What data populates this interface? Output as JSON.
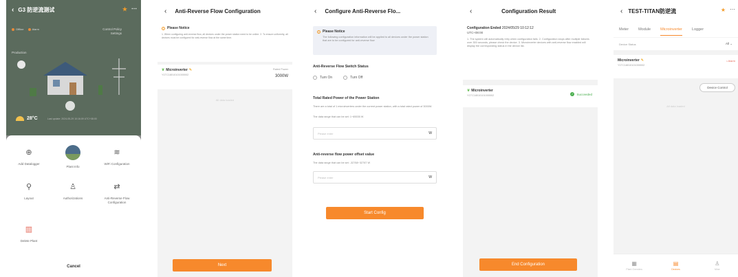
{
  "screen1": {
    "title": "G3 防逆流测试",
    "chips": [
      "Offline",
      "Alarm"
    ],
    "policy": "Control Policy Settings",
    "production": "Production",
    "temperature": "28°C",
    "note": "Last update: 2024-05-29 10:16:09 UTC+08:00",
    "menu": [
      {
        "icon": "⊕",
        "name": "add-icon",
        "label": "Add Datalogger"
      },
      {
        "icon": "",
        "name": "plant-photo-icon",
        "label": "Plant Info"
      },
      {
        "icon": "≋",
        "name": "wifi-icon",
        "label": "WiFi Configuration"
      },
      {
        "icon": "⚲",
        "name": "layout-icon",
        "label": "Layout"
      },
      {
        "icon": "♙",
        "name": "user-icon",
        "label": "Authorizations"
      },
      {
        "icon": "⇄",
        "name": "reverse-flow-icon",
        "label": "Anti-Reverse Flow Configuration"
      },
      {
        "icon": "▥",
        "name": "delete-icon",
        "label": "Delete Plant"
      }
    ],
    "cancel": "Cancel"
  },
  "screen2": {
    "title": "Anti-Reverse Flow Configuration",
    "notice_title": "Please Notice",
    "notice_text": "1. When configuring anti-reverse flow, all devices under the power station need to be online. 2. To ensure uniformity, all devices must be configured for anti-reverse flow at the same time.",
    "device_name": "Microinverter",
    "device_sn": "Y1TC18010101000002",
    "rated_label": "Rated Power",
    "rated_value": "3000W",
    "no_data": "All data loaded",
    "next": "Next"
  },
  "screen3": {
    "title": "Configure Anti-Reverse Flo...",
    "notice_title": "Please Notice",
    "notice_text": "The following configuration information will be applied to all devices under the power station that are to be configured for anti-reverse flow",
    "switch_title": "Anti-Reverse Flow Switch Status",
    "turn_on": "Turn On",
    "turn_off": "Turn Off",
    "total_title": "Total Rated Power of the Power Station",
    "total_desc": "There are a total of 1 microinverters under the current power station, with a total rated power of 3000W",
    "total_range": "The data range that can be set: 1~65535 W",
    "placeholder": "Please enter",
    "unit": "W",
    "offset_title": "Anti-reverse flow power offset value",
    "offset_range": "The data range that can be set: -32768~32767 W",
    "start": "Start Config"
  },
  "screen4": {
    "title": "Configuration Result",
    "ended_label": "Configuration Ended",
    "ended_time": "2024/05/29 10:12:12",
    "timezone": "UTC+08:00",
    "notes": "1. The system will automatically retry when configuration fails. 2. Configuration stops after multiple failures over 300 seconds, please check the device. 3. Microinverter devices with anti-reverse flow enabled will display the corresponding status in the device list.",
    "device_name": "Microinverter",
    "device_sn": "Y1TC18010101000002",
    "status": "Succeeded",
    "end": "End Configuration"
  },
  "screen5": {
    "title": "TEST-TITAN防逆流",
    "tabs": [
      "Meter",
      "Module",
      "Microinverter",
      "Logger"
    ],
    "status_label": "Device Status",
    "status_value": "All",
    "device_name": "Microinverter",
    "device_sn": "Y1TC18010101000002",
    "alarm": "• Alarm",
    "device_control": "Device Control",
    "no_data": "All data loaded",
    "nav": [
      "Plant Overview",
      "Devices",
      "Mine"
    ]
  },
  "colors": {
    "accent": "#f7892c",
    "success": "#4caf50",
    "warn": "#f39c2b"
  }
}
